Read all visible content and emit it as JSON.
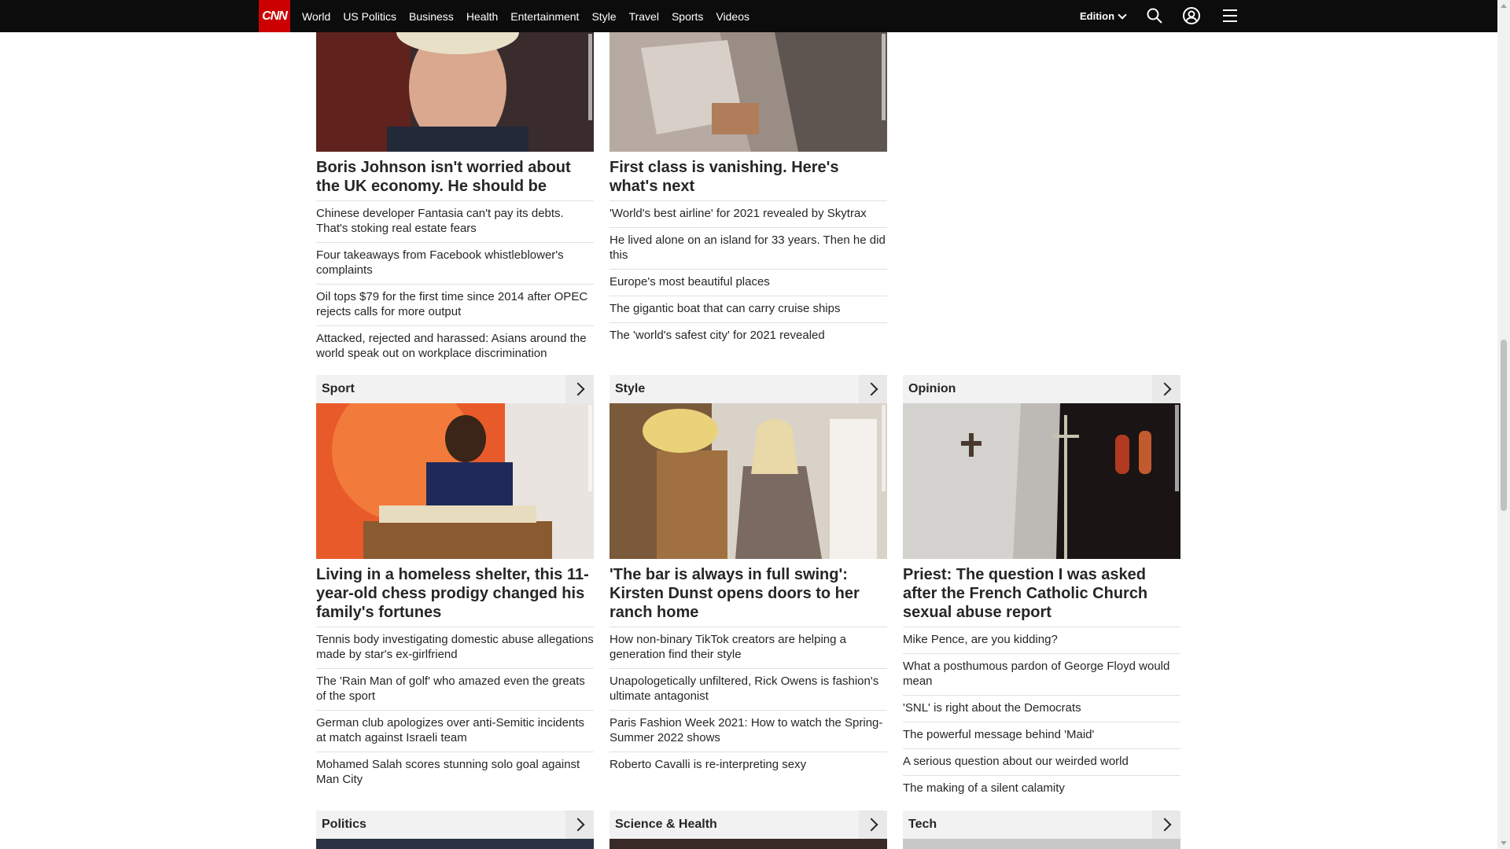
{
  "nav": {
    "logo": "CNN",
    "links": [
      "World",
      "US Politics",
      "Business",
      "Health",
      "Entertainment",
      "Style",
      "Travel",
      "Sports",
      "Videos"
    ],
    "edition": "Edition"
  },
  "top": {
    "left": {
      "headline": "Boris Johnson isn't worried about the UK economy. He should be",
      "stories": [
        "Chinese developer Fantasia can't pay its debts. That's stoking real estate fears",
        "Four takeaways from Facebook whistleblower's complaints",
        "Oil tops $79 for the first time since 2014 after OPEC rejects calls for more output",
        "Attacked, rejected and harassed: Asians around the world speak out on workplace discrimination"
      ]
    },
    "middle": {
      "headline": "First class is vanishing. Here's what's next",
      "stories": [
        "'World's best airline' for 2021 revealed by Skytrax",
        "He lived alone on an island for 33 years. Then he did this",
        "Europe's most beautiful places",
        "The gigantic boat that can carry cruise ships",
        "The 'world's safest city' for 2021 revealed"
      ]
    }
  },
  "sections": {
    "sport": {
      "title": "Sport",
      "headline": "Living in a homeless shelter, this 11-year-old chess prodigy changed his family's fortunes",
      "stories": [
        "Tennis body investigating domestic abuse allegations made by star's ex-girlfriend",
        "The 'Rain Man of golf' who amazed even the greats of the sport",
        "German club apologizes over anti-Semitic incidents at match against Israeli team",
        "Mohamed Salah scores stunning solo goal against Man City"
      ]
    },
    "style": {
      "title": "Style",
      "headline": "'The bar is always in full swing': Kirsten Dunst opens doors to her ranch home",
      "stories": [
        "How non-binary TikTok creators are helping a generation find their style",
        "Unapologetically unfiltered, Rick Owens is fashion's ultimate antagonist",
        "Paris Fashion Week 2021: How to watch the Spring-Summer 2022 shows",
        "Roberto Cavalli is re-interpreting sexy"
      ]
    },
    "opinion": {
      "title": "Opinion",
      "headline": "Priest: The question I was asked after the French Catholic Church sexual abuse report",
      "stories": [
        "Mike Pence, are you kidding?",
        "What a posthumous pardon of George Floyd would mean",
        "'SNL' is right about the Democrats",
        "The powerful message behind 'Maid'",
        "A serious question about our weirded world",
        "The making of a silent calamity"
      ]
    },
    "politics": {
      "title": "Politics"
    },
    "science": {
      "title": "Science & Health"
    },
    "tech": {
      "title": "Tech"
    }
  },
  "colors": {
    "brand": "#cc0000",
    "nav_bg": "#0c0c0c",
    "section_header_bg": "#f2f2f2"
  },
  "icons": [
    "search-icon",
    "account-icon",
    "menu-icon",
    "chevron-right-icon"
  ]
}
